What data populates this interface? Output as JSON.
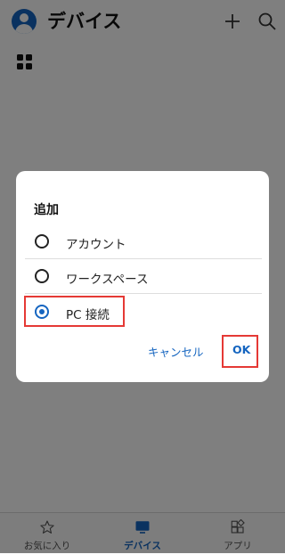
{
  "header": {
    "title": "デバイス"
  },
  "dialog": {
    "title": "追加",
    "options": [
      {
        "label": "アカウント",
        "selected": false
      },
      {
        "label": "ワークスペース",
        "selected": false
      },
      {
        "label": "PC 接続",
        "selected": true
      }
    ],
    "cancel_label": "キャンセル",
    "ok_label": "OK"
  },
  "bottom_nav": {
    "items": [
      {
        "label": "お気に入り",
        "icon": "star-icon",
        "active": false
      },
      {
        "label": "デバイス",
        "icon": "monitor-icon",
        "active": true
      },
      {
        "label": "アプリ",
        "icon": "apps-icon",
        "active": false
      }
    ]
  },
  "colors": {
    "accent": "#1565c0",
    "highlight_border": "#e53935",
    "scrim": "rgba(0,0,0,0.5)"
  }
}
